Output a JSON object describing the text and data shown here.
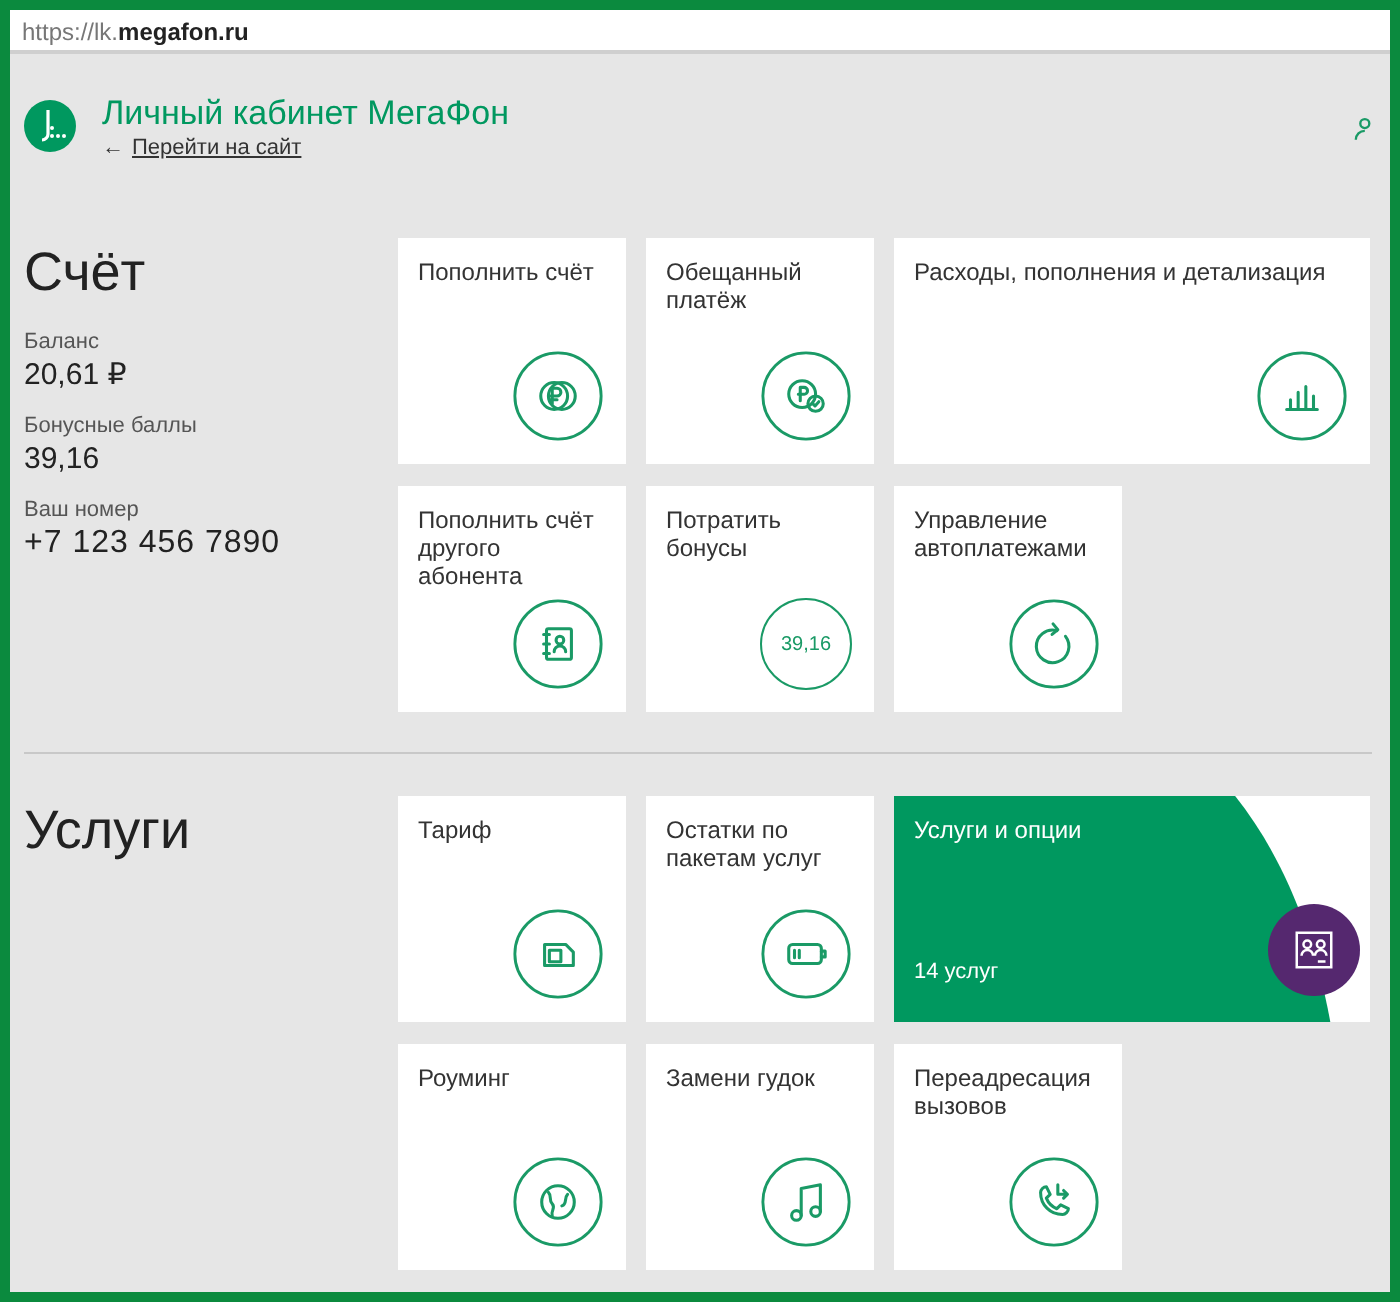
{
  "address_bar": {
    "url": "https://lk.**megafon.ru**"
  },
  "header": {
    "title": "Личный кабинет МегаФон",
    "back_arrow": "←",
    "back_link": "Перейти на сайт"
  },
  "sections": [
    {
      "title": "Счёт",
      "info": [
        {
          "label": "Баланс",
          "value": "20,61 ₽"
        },
        {
          "label": "Бонусные баллы",
          "value": "39,16"
        },
        {
          "label": "Ваш номер",
          "value": "+7 123 456 7890",
          "kind": "phone"
        }
      ],
      "tiles": [
        {
          "title": "Пополнить счёт",
          "kind": "icon"
        },
        {
          "title": "Обещанный платёж",
          "kind": "icon"
        },
        {
          "title": "Расходы, пополнения и детализация",
          "kind": "wide"
        },
        {
          "title": "Пополнить счёт другого абонента",
          "kind": "icon"
        },
        {
          "title": "Потратить бонусы",
          "kind": "value",
          "value": "39,16"
        },
        {
          "title": "Управление автоплатежами",
          "kind": "icon"
        }
      ]
    },
    {
      "title": "Услуги",
      "tiles": [
        {
          "title": "Тариф",
          "kind": "icon"
        },
        {
          "title": "Остатки по пакетам услуг",
          "kind": "icon"
        },
        {
          "title": "Услуги и опции",
          "kind": "featured",
          "count": "14 услуг"
        },
        {
          "title": "Роуминг",
          "kind": "icon"
        },
        {
          "title": "Замени гудок",
          "kind": "icon"
        },
        {
          "title": "Переадресация вызовов",
          "kind": "icon"
        }
      ]
    }
  ]
}
